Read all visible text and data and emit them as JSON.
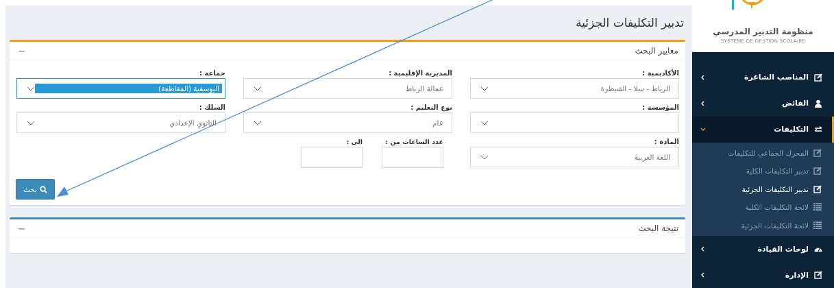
{
  "page_title": "تدبير التكليفات الجزئية",
  "search_panel": {
    "title": "معايير البحث",
    "collapse": "−",
    "fields": [
      {
        "kind": "select",
        "label": "الأكاديمية :",
        "value": "الرباط - سلا - القنيطرة",
        "focused": false
      },
      {
        "kind": "select",
        "label": "المديرية الإقليمية :",
        "value": "عمالة الرباط",
        "focused": false
      },
      {
        "kind": "select",
        "label": "جماعة :",
        "value": "اليوسفية (المقاطعة)",
        "focused": true
      },
      {
        "kind": "select",
        "label": "المؤسسة :",
        "focused": false
      },
      {
        "kind": "select",
        "label": "نوع التعليم :",
        "value": "عام",
        "focused": false
      },
      {
        "kind": "select",
        "label": "السلك :",
        "value": "الثانوي الإعدادي",
        "focused": false
      },
      {
        "kind": "select",
        "label": "المادة :",
        "value": "اللغة العربية",
        "focused": false
      },
      {
        "kind": "range",
        "from_label": "عدد الساعات من :",
        "to_label": "الى :"
      }
    ],
    "button": "بحث"
  },
  "result_panel": {
    "title": "نتيجة البحث",
    "collapse": "−"
  },
  "logo": {
    "title": "منظومة التدبير المدرسي",
    "subtitle": "SYSTÈME DE GESTION SCOLAIRE"
  },
  "sidebar": {
    "items": [
      {
        "kind": "edit",
        "label": "المناصب الشاغرة",
        "selected": false,
        "expanded": false
      },
      {
        "kind": "user",
        "label": "الفائض",
        "selected": false,
        "expanded": false
      },
      {
        "kind": "exchange",
        "label": "التكليفات",
        "selected": true,
        "expanded": true,
        "children": [
          {
            "kind": "edit",
            "label": "المحرك الجماعي للتكليفات",
            "selected": false
          },
          {
            "kind": "edit",
            "label": "تدبير التكليفات الكلية",
            "selected": false
          },
          {
            "kind": "edit",
            "label": "تدبير التكليفات الجزئية",
            "selected": true
          },
          {
            "kind": "list",
            "label": "لائحة التكليفات الكلية",
            "selected": false
          },
          {
            "kind": "list",
            "label": "لائحة التكليفات الجزئية",
            "selected": false
          }
        ]
      },
      {
        "kind": "gauge",
        "label": "لوحات القيادة",
        "selected": false,
        "expanded": false
      },
      {
        "kind": "edit",
        "label": "الإدارة",
        "selected": false,
        "expanded": false
      }
    ]
  }
}
